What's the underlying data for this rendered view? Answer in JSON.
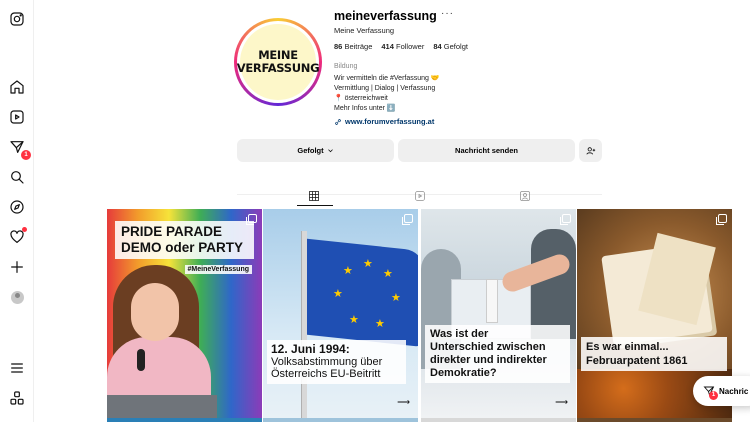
{
  "nav": {
    "badges": {
      "notifications": "1"
    }
  },
  "profile": {
    "logo_line1": "MEINE",
    "logo_line2": "VERFASSUNG",
    "handle": "meineverfassung",
    "more": "···",
    "name": "Meine Verfassung",
    "stats": {
      "posts_count": "86",
      "posts_label": "Beiträge",
      "followers_count": "414",
      "followers_label": "Follower",
      "following_count": "84",
      "following_label": "Gefolgt"
    },
    "category": "Bildung",
    "bio": [
      "Wir vermitteln die #Verfassung 🤝",
      "Vermittlung | Dialog | Verfassung",
      "📍 österreichweit",
      "Mehr Infos unter ⬇️"
    ],
    "link": "www.forumverfassung.at"
  },
  "actions": {
    "follow_label": "Gefolgt",
    "message_label": "Nachricht senden"
  },
  "posts": [
    {
      "title_line1": "PRIDE PARADE",
      "title_line2": "DEMO oder PARTY",
      "hashtag": "#MeineVerfassung"
    },
    {
      "title_line1": "12. Juni 1994:",
      "title_line2": "Volksabstimmung über",
      "title_line3": "Österreichs EU-Beitritt"
    },
    {
      "title_line1": "Was ist der",
      "title_line2": "Unterschied zwischen",
      "title_line3": "direkter und indirekter",
      "title_line4": "Demokratie?"
    },
    {
      "title_line1": "Es war einmal...",
      "title_line2": "Februarpatent 1861"
    }
  ],
  "messages_pill": {
    "label": "Nachric",
    "badge": "1"
  },
  "colors": {
    "accent_link": "#00376b",
    "badge_red": "#ff3040",
    "button_bg": "#efefef"
  }
}
